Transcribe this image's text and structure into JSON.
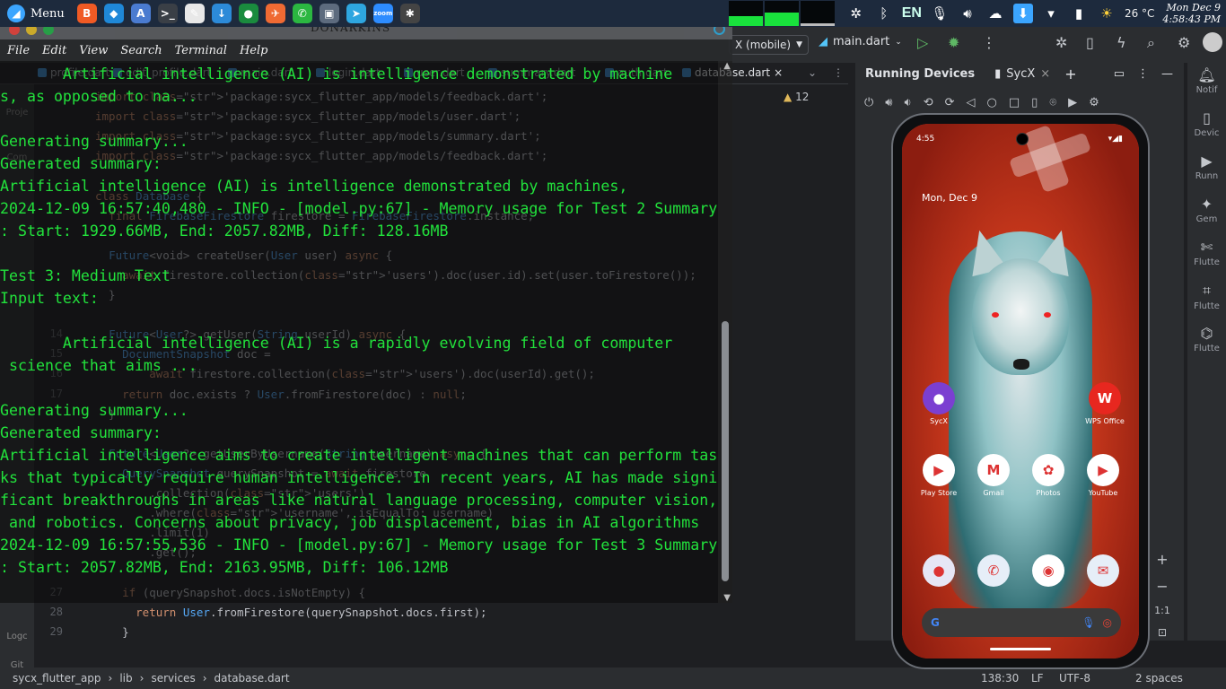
{
  "topbar": {
    "menu_label": "Menu",
    "launchers": [
      {
        "icon": "brave-icon",
        "glyph": "B",
        "color": "#f05a24"
      },
      {
        "icon": "vscode-icon",
        "glyph": "◆",
        "color": "#1f88d8"
      },
      {
        "icon": "android-studio-icon",
        "glyph": "A",
        "color": "#4a7bd0"
      },
      {
        "icon": "terminal-icon",
        "glyph": ">_",
        "color": "#3a3f46"
      },
      {
        "icon": "document-icon",
        "glyph": "✎",
        "color": "#e8e8e8"
      },
      {
        "icon": "download-manager-icon",
        "glyph": "↓",
        "color": "#2c8ad8"
      },
      {
        "icon": "mongodb-icon",
        "glyph": "●",
        "color": "#1a8b3e"
      },
      {
        "icon": "postman-icon",
        "glyph": "✈",
        "color": "#ef6a33"
      },
      {
        "icon": "whatsapp-icon",
        "glyph": "✆",
        "color": "#2bb741"
      },
      {
        "icon": "virtual-machine-icon",
        "glyph": "▣",
        "color": "#5d6b7e"
      },
      {
        "icon": "telegram-icon",
        "glyph": "➤",
        "color": "#2ea6e0"
      },
      {
        "icon": "zoom-icon",
        "glyph": "zoom",
        "color": "#2d8cff"
      },
      {
        "icon": "color-wheel-icon",
        "glyph": "✱",
        "color": "#444"
      }
    ],
    "language": "EN",
    "temperature": "26 °C",
    "date": "Mon Dec  9",
    "time": "4:58:43 PM"
  },
  "terminal": {
    "title": "DONARKINS",
    "menu": [
      "File",
      "Edit",
      "View",
      "Search",
      "Terminal",
      "Help"
    ],
    "lines": [
      "       Artificial intelligence (AI) is intelligence demonstrated by machine",
      "s, as opposed to na...",
      "",
      "Generating summary...",
      "Generated summary:",
      "Artificial intelligence (AI) is intelligence demonstrated by machines,",
      "2024-12-09 16:57:40,480 - INFO - [model.py:67] - Memory usage for Test 2 Summary",
      ": Start: 1929.66MB, End: 2057.82MB, Diff: 128.16MB",
      "",
      "Test 3: Medium Text",
      "Input text:",
      "",
      "       Artificial intelligence (AI) is a rapidly evolving field of computer",
      " science that aims ...",
      "",
      "Generating summary...",
      "Generated summary:",
      "Artificial intelligence aims to create intelligent machines that can perform tas",
      "ks that typically require human intelligence. In recent years, AI has made signi",
      "ficant breakthroughs in areas like natural language processing, computer vision,",
      " and robotics. Concerns about privacy, job displacement, bias in AI algorithms",
      "2024-12-09 16:57:55,536 - INFO - [model.py:67] - Memory usage for Test 3 Summary",
      ": Start: 2057.82MB, End: 2163.95MB, Diff: 106.12MB"
    ]
  },
  "ide": {
    "device_selector": "X (mobile)",
    "run_config": "main.dart",
    "file_tabs": [
      "profile.dart",
      "edit_profile.dart",
      "main.dart",
      "login.dart",
      "user.dart",
      "summary.dart",
      "auth.dart",
      "database.dart"
    ],
    "left_tools": [
      "Proje",
      "Com",
      "Logc",
      "Git"
    ],
    "warnings_count": "12",
    "code_lines": [
      {
        "n": "1",
        "t": "import 'package:sycx_flutter_app/models/feedback.dart';"
      },
      {
        "n": "",
        "t": "import 'package:sycx_flutter_app/models/user.dart';"
      },
      {
        "n": "",
        "t": "import 'package:sycx_flutter_app/models/summary.dart';"
      },
      {
        "n": "",
        "t": "import 'package:sycx_flutter_app/models/feedback.dart';"
      },
      {
        "n": "",
        "t": ""
      },
      {
        "n": "",
        "t": "class Database {"
      },
      {
        "n": "",
        "t": "  final FirebaseFirestore firestore = FirebaseFirestore.instance;"
      },
      {
        "n": "",
        "t": ""
      },
      {
        "n": "",
        "t": "  Future<void> createUser(User user) async {"
      },
      {
        "n": "",
        "t": "    await firestore.collection('users').doc(user.id).set(user.toFirestore());"
      },
      {
        "n": "",
        "t": "  }"
      },
      {
        "n": "",
        "t": ""
      },
      {
        "n": "14",
        "t": "  Future<User?> getUser(String userId) async {"
      },
      {
        "n": "15",
        "t": "    DocumentSnapshot doc ="
      },
      {
        "n": "16",
        "t": "        await firestore.collection('users').doc(userId).get();"
      },
      {
        "n": "17",
        "t": "    return doc.exists ? User.fromFirestore(doc) : null;"
      },
      {
        "n": "",
        "t": "  }"
      },
      {
        "n": "",
        "t": ""
      },
      {
        "n": "",
        "t": "  Future<User?> getUserByUsername(String username) async {"
      },
      {
        "n": "",
        "t": "    QuerySnapshot querySnapshot = await firestore"
      },
      {
        "n": "",
        "t": "        .collection('users')"
      },
      {
        "n": "",
        "t": "        .where('username', isEqualTo: username)"
      },
      {
        "n": "",
        "t": "        .limit(1)"
      },
      {
        "n": "",
        "t": "        .get();"
      },
      {
        "n": "",
        "t": ""
      },
      {
        "n": "27",
        "t": "    if (querySnapshot.docs.isNotEmpty) {"
      },
      {
        "n": "28",
        "t": "      return User.fromFirestore(querySnapshot.docs.first);"
      },
      {
        "n": "29",
        "t": "    }"
      }
    ],
    "statusbar": {
      "breadcrumb": [
        "sycx_flutter_app",
        "lib",
        "services",
        "database.dart"
      ],
      "position": "138:30",
      "line_sep": "LF",
      "encoding": "UTF-8",
      "indent": "2 spaces"
    }
  },
  "running_devices": {
    "title": "Running Devices",
    "device_tab": "SycX",
    "right_tools": [
      "Notif",
      "Devic",
      "Runn",
      "Gem",
      "Flutte",
      "Flutte",
      "Flutte"
    ],
    "zoom_label": "1:1"
  },
  "phone": {
    "time": "4:55",
    "date": "Mon, Dec 9",
    "apps_row1": [
      {
        "name": "SycX",
        "icon": "sycx-app-icon",
        "bg": "#7b3fd1",
        "glyph": "●"
      },
      {
        "name": "WPS Office",
        "icon": "wps-office-icon",
        "bg": "#e7271f",
        "glyph": "W"
      }
    ],
    "apps_row2": [
      {
        "name": "Play Store",
        "icon": "play-store-icon",
        "bg": "#ffffff",
        "glyph": "▶"
      },
      {
        "name": "Gmail",
        "icon": "gmail-icon",
        "bg": "#ffffff",
        "glyph": "M"
      },
      {
        "name": "Photos",
        "icon": "photos-icon",
        "bg": "#ffffff",
        "glyph": "✿"
      },
      {
        "name": "YouTube",
        "icon": "youtube-icon",
        "bg": "#ffffff",
        "glyph": "▶"
      }
    ],
    "dock": [
      {
        "icon": "sycx-dock-icon",
        "bg": "#e6e6f5",
        "glyph": "●"
      },
      {
        "icon": "phone-icon",
        "bg": "#e6eef8",
        "glyph": "✆"
      },
      {
        "icon": "chrome-icon",
        "bg": "#ffffff",
        "glyph": "◉"
      },
      {
        "icon": "messages-icon",
        "bg": "#e6eef8",
        "glyph": "✉"
      }
    ],
    "search_g": "G"
  }
}
